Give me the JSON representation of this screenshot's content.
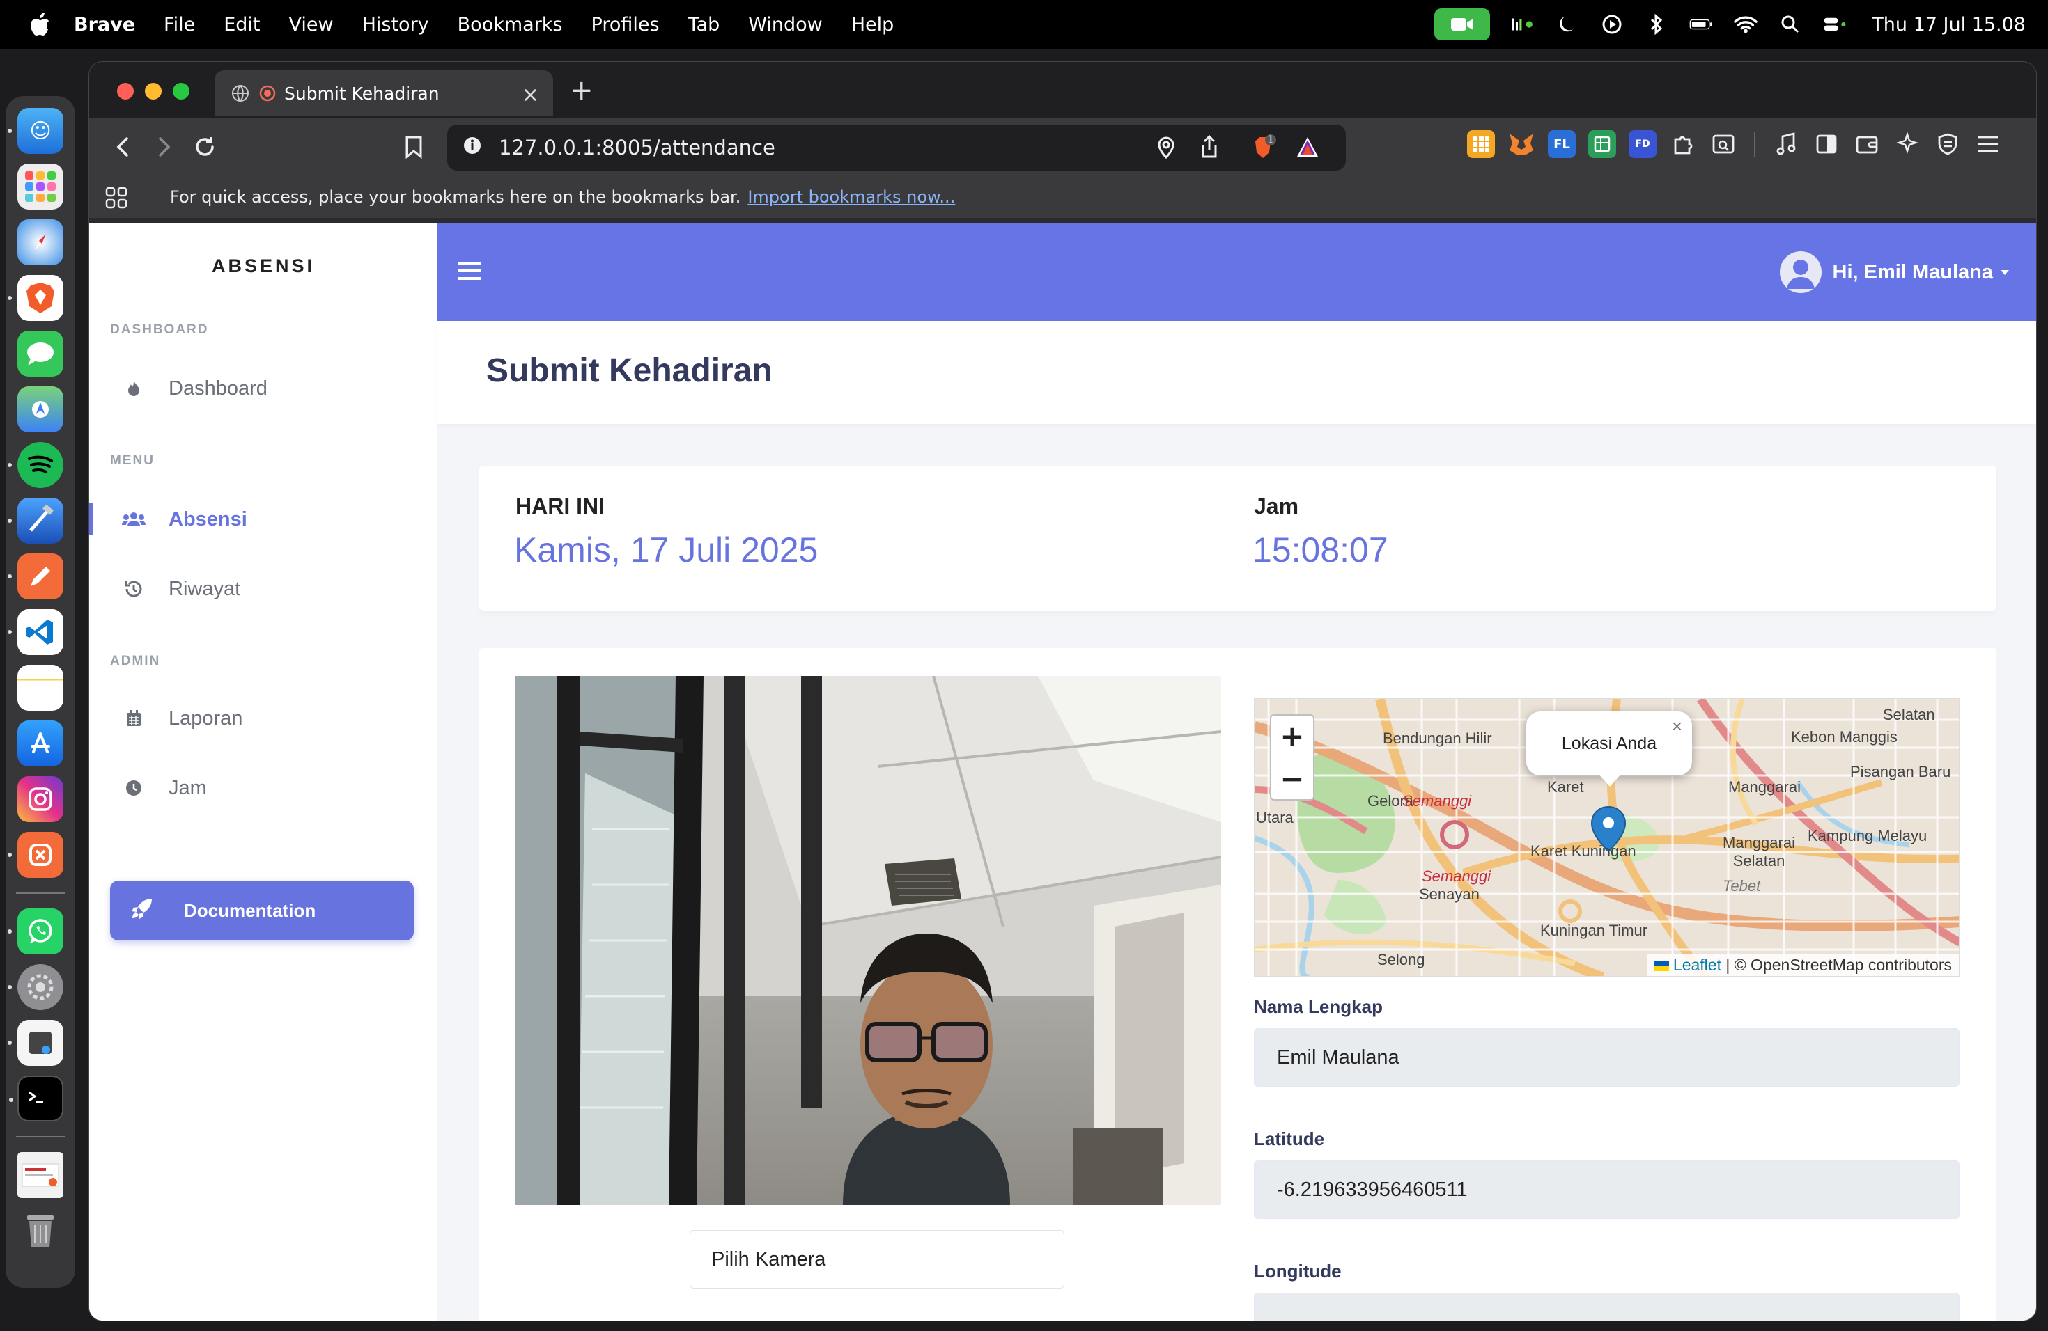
{
  "menubar": {
    "app": "Brave",
    "items": [
      "File",
      "Edit",
      "View",
      "History",
      "Bookmarks",
      "Profiles",
      "Tab",
      "Window",
      "Help"
    ],
    "clock": "Thu 17 Jul  15.08"
  },
  "browser": {
    "tab_title": "Submit Kehadiran",
    "url": "127.0.0.1:8005/attendance",
    "bookmark_hint": "For quick access, place your bookmarks here on the bookmarks bar.",
    "bookmark_import": "Import bookmarks now...",
    "ext_badge": "1"
  },
  "sidebar": {
    "brand": "ABSENSI",
    "sections": {
      "dashboard": "DASHBOARD",
      "menu": "MENU",
      "admin": "ADMIN"
    },
    "items": {
      "dashboard": "Dashboard",
      "absensi": "Absensi",
      "riwayat": "Riwayat",
      "laporan": "Laporan",
      "jam": "Jam"
    },
    "documentation": "Documentation"
  },
  "topnav": {
    "greeting": "Hi, Emil Maulana"
  },
  "page": {
    "title": "Submit Kehadiran"
  },
  "today": {
    "day_label": "HARI INI",
    "day_value": "Kamis, 17 Juli 2025",
    "time_label": "Jam",
    "time_value": "15:08:07"
  },
  "camera": {
    "select_value": "Pilih Kamera"
  },
  "map": {
    "popup": "Lokasi Anda",
    "zoom_in": "+",
    "zoom_out": "−",
    "attribution_leaflet": "Leaflet",
    "attribution_osm": "| © OpenStreetMap contributors",
    "labels": [
      "Bendungan Hilir",
      "Gelora",
      "Semanggi",
      "Karet",
      "Karet Kuningan",
      "Senayan",
      "Kuningan Timur",
      "Selong",
      "Kebon Manggis",
      "Manggarai",
      "Pisangan Baru",
      "Manggarai Selatan",
      "Kampung Melayu",
      "Utara",
      "Selatan",
      "Semanggi",
      "Tebet"
    ]
  },
  "form": {
    "name_label": "Nama Lengkap",
    "name_value": "Emil Maulana",
    "lat_label": "Latitude",
    "lat_value": "-6.219633956460511",
    "lng_label": "Longitude",
    "lng_value": ""
  },
  "colors": {
    "accent": "#6774df",
    "topnav": "#6774e5"
  }
}
